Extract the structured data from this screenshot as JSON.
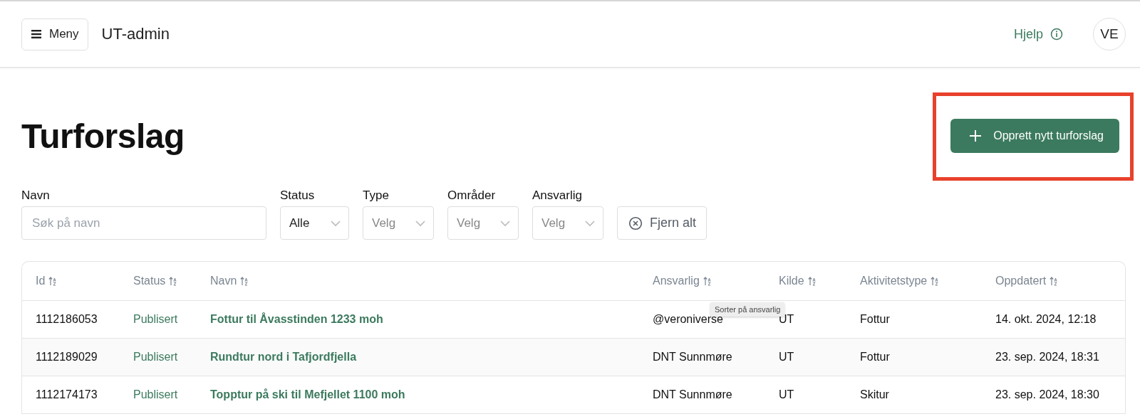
{
  "header": {
    "menu_button": "Meny",
    "app_title": "UT-admin",
    "help_link": "Hjelp",
    "avatar": "VE"
  },
  "page_title": "Turforslag",
  "create_button": {
    "label": "Opprett nytt turforslag",
    "highlighted": true
  },
  "filters": [
    {
      "kind": "text",
      "label": "Navn",
      "placeholder": "Søk på navn"
    },
    {
      "kind": "select",
      "label": "Status",
      "value": "Alle"
    },
    {
      "kind": "select",
      "label": "Type",
      "placeholder": "Velg"
    },
    {
      "kind": "select",
      "label": "Områder",
      "placeholder": "Velg"
    },
    {
      "kind": "select",
      "label": "Ansvarlig",
      "placeholder": "Velg"
    },
    {
      "kind": "clear",
      "label": "Fjern alt"
    }
  ],
  "table": {
    "columns": [
      {
        "label": "Id"
      },
      {
        "label": "Status"
      },
      {
        "label": "Navn"
      },
      {
        "label": "Ansvarlig",
        "tooltip": "Sorter på ansvarlig"
      },
      {
        "label": "Kilde"
      },
      {
        "label": "Aktivitetstype"
      },
      {
        "label": "Oppdatert"
      }
    ],
    "rows": [
      {
        "cells": [
          "1112186053",
          "Publisert",
          "Fottur til Åvasstinden 1233 moh",
          "@veroniverse",
          "UT",
          "Fottur",
          "14. okt. 2024, 12:18"
        ]
      },
      {
        "cells": [
          "1112189029",
          "Publisert",
          "Rundtur nord i Tafjordfjella",
          "DNT Sunnmøre",
          "UT",
          "Fottur",
          "23. sep. 2024, 18:31"
        ]
      },
      {
        "cells": [
          "1112174173",
          "Publisert",
          "Topptur på ski til Mefjellet 1100 moh",
          "DNT Sunnmøre",
          "UT",
          "Skitur",
          "23. sep. 2024, 18:30"
        ]
      }
    ]
  }
}
